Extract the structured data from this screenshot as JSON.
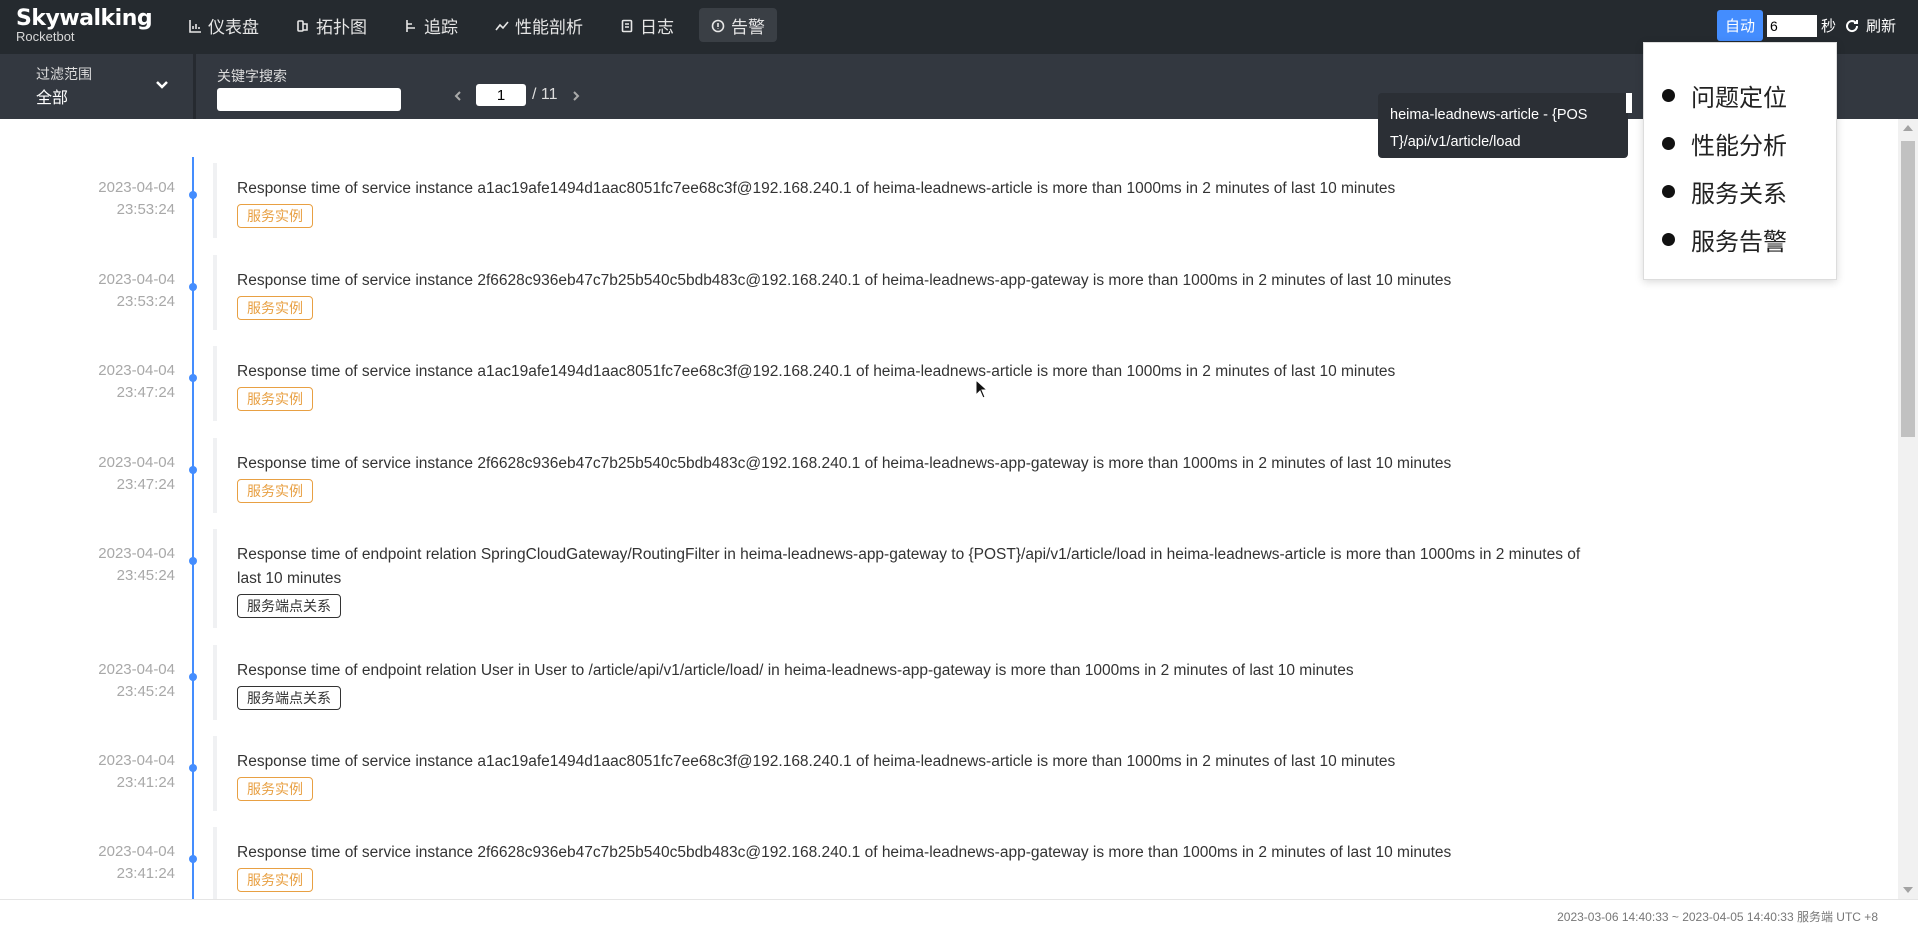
{
  "logo": {
    "main": "Skywalking",
    "sub": "Rocketbot"
  },
  "nav": [
    {
      "label": "仪表盘",
      "icon": "bar-chart-icon"
    },
    {
      "label": "拓扑图",
      "icon": "topology-icon"
    },
    {
      "label": "追踪",
      "icon": "trace-icon"
    },
    {
      "label": "性能剖析",
      "icon": "trend-icon"
    },
    {
      "label": "日志",
      "icon": "log-icon"
    },
    {
      "label": "告警",
      "icon": "alarm-icon",
      "active": true
    }
  ],
  "top_right": {
    "auto_label": "自动",
    "interval_value": "6",
    "unit": "秒",
    "refresh_label": "刷新"
  },
  "filter": {
    "scope_label": "过滤范围",
    "scope_value": "全部",
    "keyword_label": "关键字搜索",
    "keyword_value": "",
    "page_current": "1",
    "page_total": "/ 11"
  },
  "alarms": [
    {
      "date": "2023-04-04",
      "time": "23:53:24",
      "message": "Response time of service instance a1ac19afe1494d1aac8051fc7ee68c3f@192.168.240.1 of heima-leadnews-article is more than 1000ms in 2 minutes of last 10 minutes",
      "tag": "服务实例",
      "tag_type": "inst"
    },
    {
      "date": "2023-04-04",
      "time": "23:53:24",
      "message": "Response time of service instance 2f6628c936eb47c7b25b540c5bdb483c@192.168.240.1 of heima-leadnews-app-gateway is more than 1000ms in 2 minutes of last 10 minutes",
      "tag": "服务实例",
      "tag_type": "inst"
    },
    {
      "date": "2023-04-04",
      "time": "23:47:24",
      "message": "Response time of service instance a1ac19afe1494d1aac8051fc7ee68c3f@192.168.240.1 of heima-leadnews-article is more than 1000ms in 2 minutes of last 10 minutes",
      "tag": "服务实例",
      "tag_type": "inst"
    },
    {
      "date": "2023-04-04",
      "time": "23:47:24",
      "message": "Response time of service instance 2f6628c936eb47c7b25b540c5bdb483c@192.168.240.1 of heima-leadnews-app-gateway is more than 1000ms in 2 minutes of last 10 minutes",
      "tag": "服务实例",
      "tag_type": "inst"
    },
    {
      "date": "2023-04-04",
      "time": "23:45:24",
      "message": "Response time of endpoint relation SpringCloudGateway/RoutingFilter in heima-leadnews-app-gateway to {POST}/api/v1/article/load in heima-leadnews-article is more than 1000ms in 2 minutes of last 10 minutes",
      "tag": "服务端点关系",
      "tag_type": "ep"
    },
    {
      "date": "2023-04-04",
      "time": "23:45:24",
      "message": "Response time of endpoint relation User in User to /article/api/v1/article/load/ in heima-leadnews-app-gateway is more than 1000ms in 2 minutes of last 10 minutes",
      "tag": "服务端点关系",
      "tag_type": "ep"
    },
    {
      "date": "2023-04-04",
      "time": "23:41:24",
      "message": "Response time of service instance a1ac19afe1494d1aac8051fc7ee68c3f@192.168.240.1 of heima-leadnews-article is more than 1000ms in 2 minutes of last 10 minutes",
      "tag": "服务实例",
      "tag_type": "inst"
    },
    {
      "date": "2023-04-04",
      "time": "23:41:24",
      "message": "Response time of service instance 2f6628c936eb47c7b25b540c5bdb483c@192.168.240.1 of heima-leadnews-app-gateway is more than 1000ms in 2 minutes of last 10 minutes",
      "tag": "服务实例",
      "tag_type": "inst"
    }
  ],
  "tooltip": {
    "line1": "heima-leadnews-article - {POS",
    "line2": "T}/api/v1/article/load"
  },
  "popup_menu": [
    "问题定位",
    "性能分析",
    "服务关系",
    "服务告警"
  ],
  "footer": {
    "text": "2023-03-06 14:40:33 ~ 2023-04-05 14:40:33  服务端  UTC +8"
  },
  "colors": {
    "accent": "#448dfe",
    "instance_tag": "#e8a043",
    "nav_bg": "#252a2f",
    "filter_bg": "#333840"
  }
}
